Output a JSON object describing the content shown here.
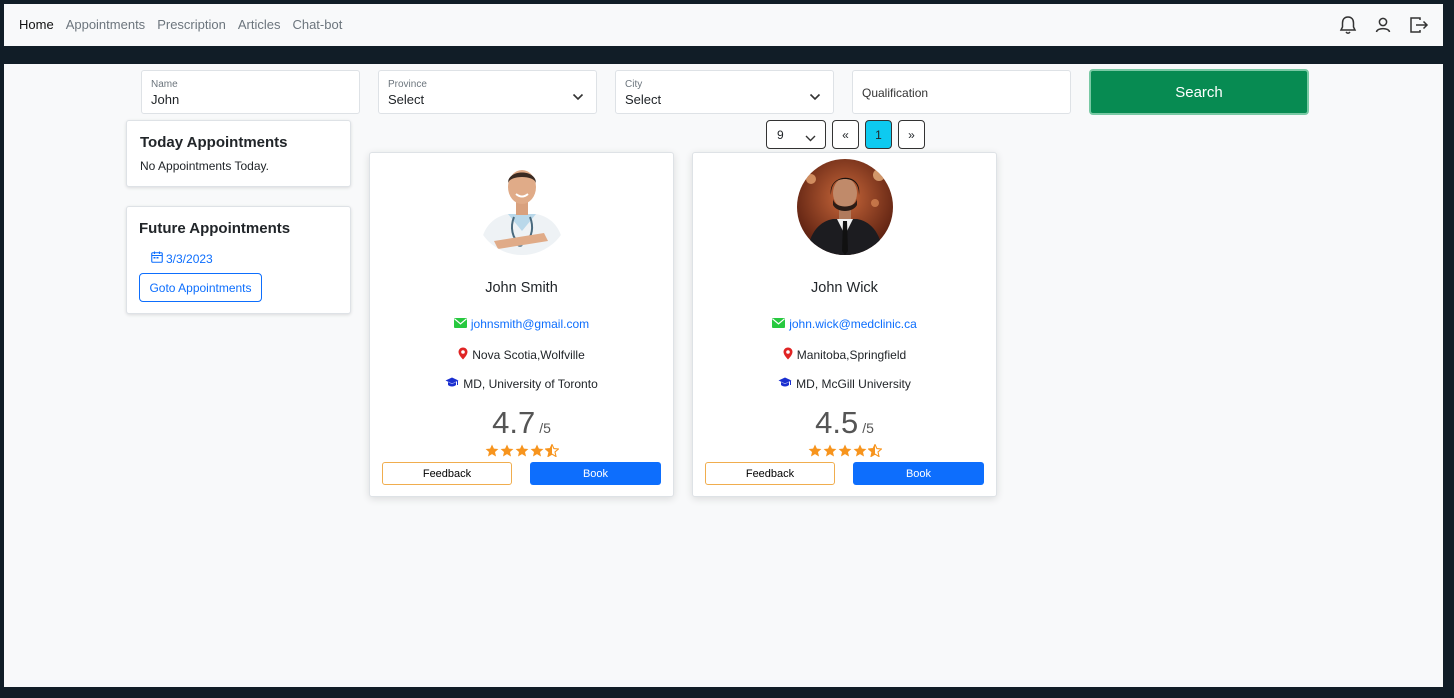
{
  "nav": {
    "items": [
      {
        "label": "Home",
        "active": true
      },
      {
        "label": "Appointments"
      },
      {
        "label": "Prescription"
      },
      {
        "label": "Articles"
      },
      {
        "label": "Chat-bot"
      }
    ],
    "icons": [
      "bell-icon",
      "user-icon",
      "logout-icon"
    ]
  },
  "filters": {
    "name": {
      "label": "Name",
      "value": "John"
    },
    "province": {
      "label": "Province",
      "value": "Select"
    },
    "city": {
      "label": "City",
      "value": "Select"
    },
    "qualification": {
      "placeholder": "Qualification"
    },
    "search_label": "Search"
  },
  "today": {
    "title": "Today Appointments",
    "text": "No Appointments Today."
  },
  "future": {
    "title": "Future Appointments",
    "date": "3/3/2023",
    "goto_label": "Goto Appointments"
  },
  "pager": {
    "page_size": "9",
    "prev": "«",
    "current": "1",
    "next": "»"
  },
  "doctors": [
    {
      "name": "John Smith",
      "email": "johnsmith@gmail.com",
      "location": "Nova Scotia,Wolfville",
      "education": "MD, University of Toronto",
      "rating": "4.7",
      "out_of": "/5",
      "stars": 4.5,
      "feedback_label": "Feedback",
      "book_label": "Book"
    },
    {
      "name": "John Wick",
      "email": "john.wick@medclinic.ca",
      "location": "Manitoba,Springfield",
      "education": "MD, McGill University",
      "rating": "4.5",
      "out_of": "/5",
      "stars": 4.5,
      "feedback_label": "Feedback",
      "book_label": "Book"
    }
  ],
  "colors": {
    "search_green": "#078b52",
    "book_blue": "#0d6efd",
    "page_active": "#0dcaf0",
    "star_orange": "#f7941d"
  }
}
